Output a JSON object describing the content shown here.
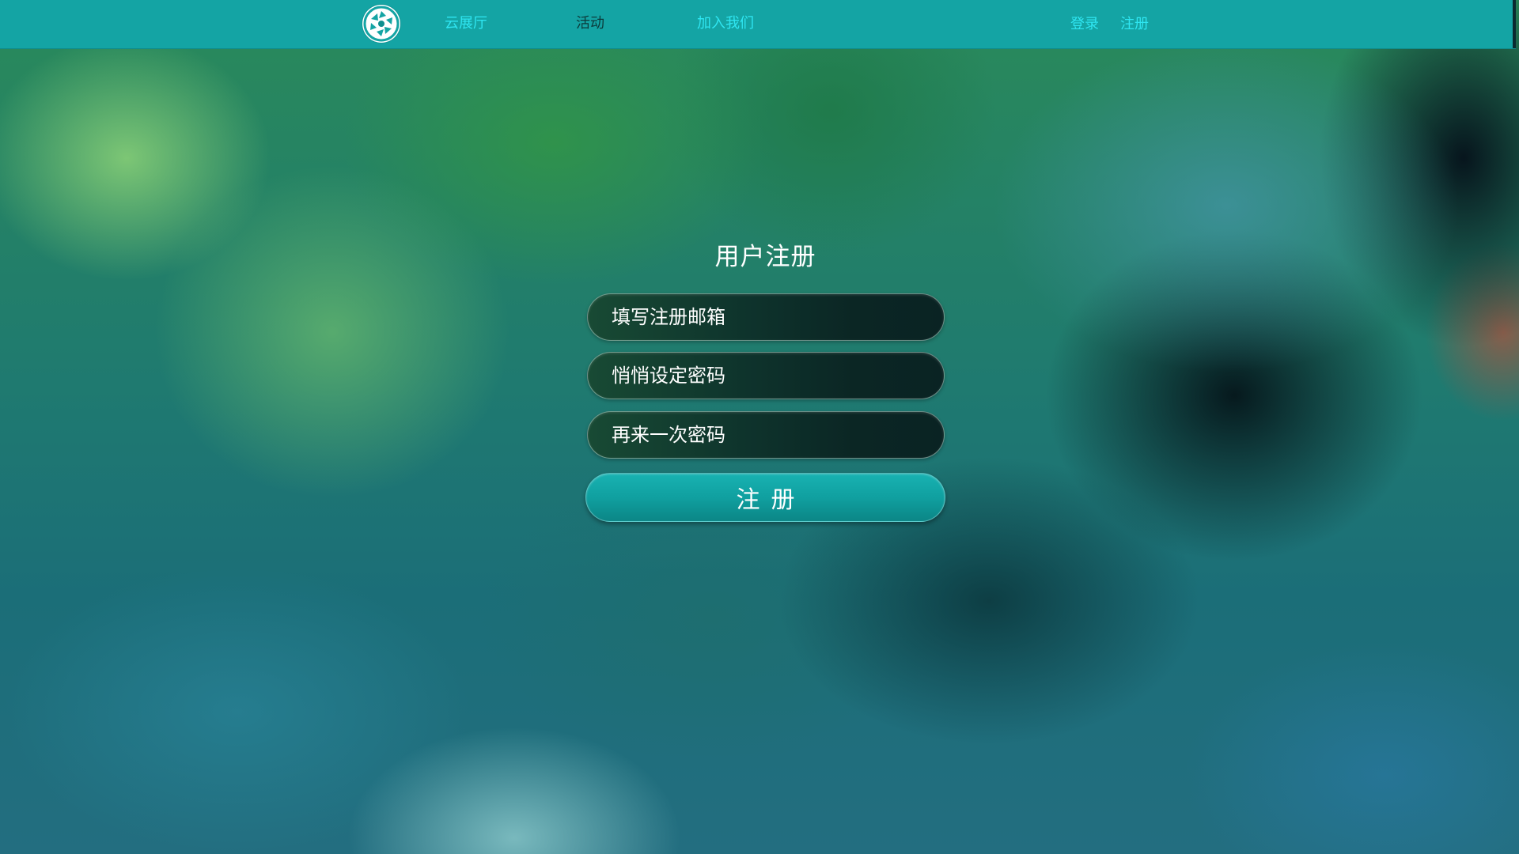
{
  "nav": {
    "logo_icon": "camera-aperture-icon",
    "items": [
      {
        "label": "云展厅",
        "color": "#2fe6f2"
      },
      {
        "label": "活动",
        "color": "#0c3a3a"
      },
      {
        "label": "加入我们",
        "color": "#2fe6f2"
      }
    ],
    "login_label": "登录",
    "register_label": "注册",
    "bar_color": "#14a4a4"
  },
  "form": {
    "title": "用户注册",
    "email_placeholder": "填写注册邮箱",
    "password_placeholder": "悄悄设定密码",
    "confirm_placeholder": "再来一次密码",
    "submit_label": "注册",
    "button_color": "#14a4a4"
  }
}
